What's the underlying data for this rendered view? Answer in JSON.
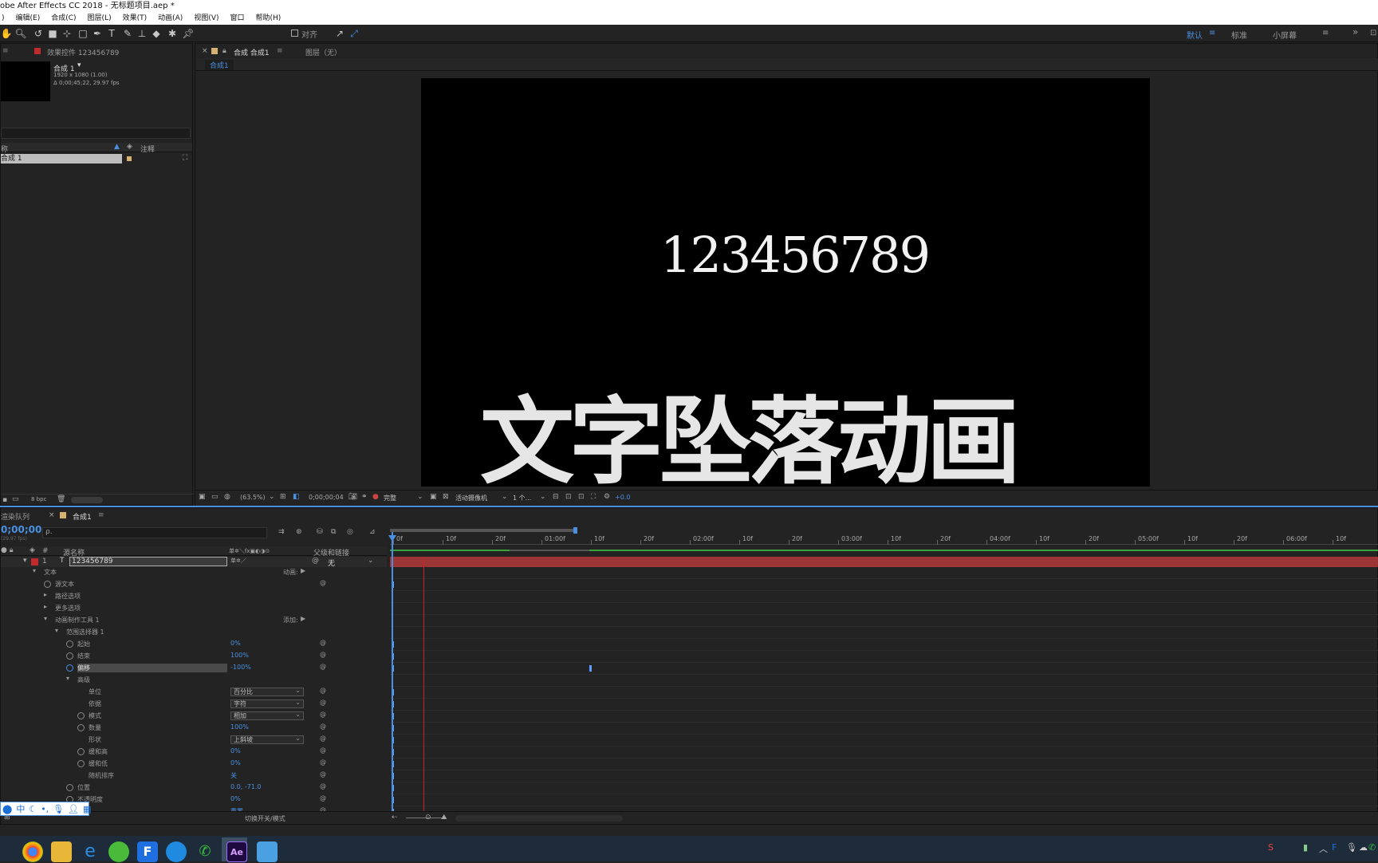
{
  "window": {
    "title": "obe After Effects CC 2018 - 无标题项目.aep *"
  },
  "menu": [
    "编辑(E)",
    "合成(C)",
    "图层(L)",
    "效果(T)",
    "动画(A)",
    "视图(V)",
    "窗口",
    "帮助(H)"
  ],
  "menu_prefix": ")",
  "toolbar": {
    "align_label": "对齐",
    "workspaces": [
      "默认",
      "标准",
      "小屏幕"
    ],
    "active_workspace": "默认"
  },
  "project": {
    "effects_tab": "效果控件 123456789",
    "comp_name": "合成 1",
    "comp_size": "1920 x 1080 (1.00)",
    "comp_duration": "Δ 0;00;45;22, 29.97 fps",
    "col_name": "称",
    "col_comment": "注释",
    "item": "合成 1",
    "bpc": "8 bpc"
  },
  "viewer": {
    "tab": "合成 合成1",
    "layer_tab": "图层（无）",
    "breadcrumb": "合成1",
    "text_numbers": "123456789",
    "text_title": "文字坠落动画",
    "zoom": "(63.5%)",
    "timecode": "0;00;00;04",
    "quality": "完整",
    "camera": "活动摄像机",
    "views": "1 个...",
    "exposure": "+0.0"
  },
  "timeline": {
    "queue_tab": "渲染队列",
    "comp_tab": "合成1",
    "timecode": "0;00;00",
    "fps": "(29.97 fps)",
    "search_placeholder": "ρ.",
    "col_source": "源名称",
    "col_parent": "父级和链接",
    "layer_num": "1",
    "layer_name": "123456789",
    "parent_value": "无",
    "footer_label": "切换开关/模式",
    "ruler": [
      "0f",
      "10f",
      "20f",
      "01:00f",
      "10f",
      "20f",
      "02:00f",
      "10f",
      "20f",
      "03:00f",
      "10f",
      "20f",
      "04:00f",
      "10f",
      "20f",
      "05:00f",
      "10f",
      "20f",
      "06:00f",
      "10f"
    ],
    "props": [
      {
        "label": "文本",
        "depth": 1,
        "twirl": "open",
        "extra": "动画:",
        "value": ""
      },
      {
        "label": "源文本",
        "depth": 2,
        "stopwatch": true,
        "value": ""
      },
      {
        "label": "路径选项",
        "depth": 2,
        "twirl": "closed",
        "value": ""
      },
      {
        "label": "更多选项",
        "depth": 2,
        "twirl": "closed",
        "value": ""
      },
      {
        "label": "动画制作工具 1",
        "depth": 2,
        "twirl": "open",
        "extra": "添加:",
        "value": ""
      },
      {
        "label": "范围选择器 1",
        "depth": 3,
        "twirl": "open",
        "value": ""
      },
      {
        "label": "起始",
        "depth": 4,
        "stopwatch": true,
        "value": "0%"
      },
      {
        "label": "结束",
        "depth": 4,
        "stopwatch": true,
        "value": "100%"
      },
      {
        "label": "偏移",
        "depth": 4,
        "stopwatch": true,
        "value": "-100%",
        "selected": true
      },
      {
        "label": "高级",
        "depth": 4,
        "twirl": "open",
        "value": ""
      },
      {
        "label": "单位",
        "depth": 5,
        "value": "",
        "dropdown": "百分比"
      },
      {
        "label": "依据",
        "depth": 5,
        "value": "",
        "dropdown": "字符"
      },
      {
        "label": "模式",
        "depth": 5,
        "stopwatch": true,
        "value": "",
        "dropdown": "相加"
      },
      {
        "label": "数量",
        "depth": 5,
        "stopwatch": true,
        "value": "100%"
      },
      {
        "label": "形状",
        "depth": 5,
        "value": "",
        "dropdown": "上斜坡"
      },
      {
        "label": "缓和高",
        "depth": 5,
        "stopwatch": true,
        "value": "0%"
      },
      {
        "label": "缓和低",
        "depth": 5,
        "stopwatch": true,
        "value": "0%"
      },
      {
        "label": "随机排序",
        "depth": 5,
        "value": "关"
      },
      {
        "label": "位置",
        "depth": 4,
        "stopwatch": true,
        "value": "0.0, -71.0"
      },
      {
        "label": "不透明度",
        "depth": 4,
        "stopwatch": true,
        "value": "0%"
      },
      {
        "label": "",
        "depth": 4,
        "value": "重置"
      }
    ]
  },
  "colors": {
    "accent": "#4a90e2",
    "track": "#b13a3a",
    "playhead": "#cc2222"
  }
}
